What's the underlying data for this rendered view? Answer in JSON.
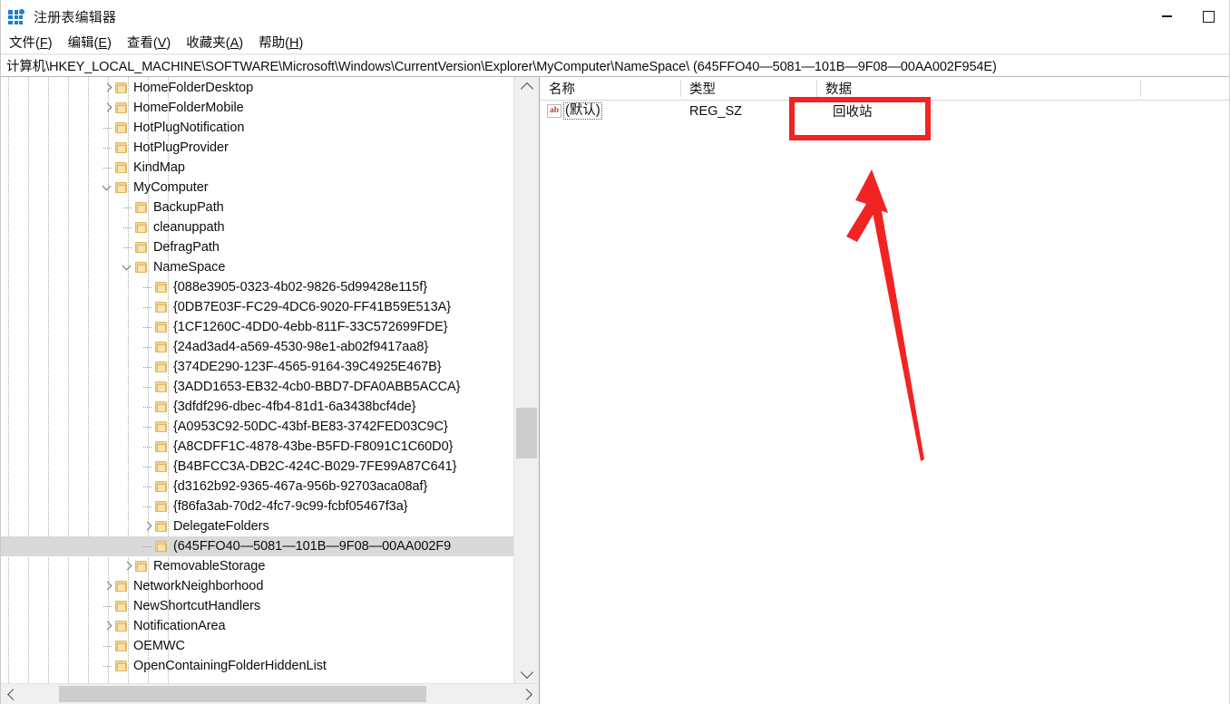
{
  "window": {
    "title": "注册表编辑器",
    "icon": "registry-editor-icon",
    "minimize_label": "最小化",
    "maximize_label": "最大化"
  },
  "menubar": {
    "items": [
      {
        "label": "文件(F)",
        "text": "文件(",
        "accel": "F",
        "tail": ")"
      },
      {
        "label": "编辑(E)",
        "text": "编辑(",
        "accel": "E",
        "tail": ")"
      },
      {
        "label": "查看(V)",
        "text": "查看(",
        "accel": "V",
        "tail": ")"
      },
      {
        "label": "收藏夹(A)",
        "text": "收藏夹(",
        "accel": "A",
        "tail": ")"
      },
      {
        "label": "帮助(H)",
        "text": "帮助(",
        "accel": "H",
        "tail": ")"
      }
    ]
  },
  "address": {
    "path": "计算机\\HKEY_LOCAL_MACHINE\\SOFTWARE\\Microsoft\\Windows\\CurrentVersion\\Explorer\\MyComputer\\NameSpace\\ (645FFO40—5081—101B—9F08—00AA002F954E)"
  },
  "tree": {
    "rows": [
      {
        "label": "HomeFolderDesktop",
        "indent": 6,
        "state": "expandable"
      },
      {
        "label": "HomeFolderMobile",
        "indent": 6,
        "state": "expandable"
      },
      {
        "label": "HotPlugNotification",
        "indent": 6,
        "state": "leaf"
      },
      {
        "label": "HotPlugProvider",
        "indent": 6,
        "state": "leaf"
      },
      {
        "label": "KindMap",
        "indent": 6,
        "state": "leaf"
      },
      {
        "label": "MyComputer",
        "indent": 6,
        "state": "expanded"
      },
      {
        "label": "BackupPath",
        "indent": 7,
        "state": "leaf"
      },
      {
        "label": "cleanuppath",
        "indent": 7,
        "state": "leaf"
      },
      {
        "label": "DefragPath",
        "indent": 7,
        "state": "leaf"
      },
      {
        "label": "NameSpace",
        "indent": 7,
        "state": "expanded"
      },
      {
        "label": "{088e3905-0323-4b02-9826-5d99428e115f}",
        "indent": 8,
        "state": "leaf"
      },
      {
        "label": "{0DB7E03F-FC29-4DC6-9020-FF41B59E513A}",
        "indent": 8,
        "state": "leaf"
      },
      {
        "label": "{1CF1260C-4DD0-4ebb-811F-33C572699FDE}",
        "indent": 8,
        "state": "leaf"
      },
      {
        "label": "{24ad3ad4-a569-4530-98e1-ab02f9417aa8}",
        "indent": 8,
        "state": "leaf"
      },
      {
        "label": "{374DE290-123F-4565-9164-39C4925E467B}",
        "indent": 8,
        "state": "leaf"
      },
      {
        "label": "{3ADD1653-EB32-4cb0-BBD7-DFA0ABB5ACCA}",
        "indent": 8,
        "state": "leaf"
      },
      {
        "label": "{3dfdf296-dbec-4fb4-81d1-6a3438bcf4de}",
        "indent": 8,
        "state": "leaf"
      },
      {
        "label": "{A0953C92-50DC-43bf-BE83-3742FED03C9C}",
        "indent": 8,
        "state": "leaf"
      },
      {
        "label": "{A8CDFF1C-4878-43be-B5FD-F8091C1C60D0}",
        "indent": 8,
        "state": "leaf"
      },
      {
        "label": "{B4BFCC3A-DB2C-424C-B029-7FE99A87C641}",
        "indent": 8,
        "state": "leaf"
      },
      {
        "label": "{d3162b92-9365-467a-956b-92703aca08af}",
        "indent": 8,
        "state": "leaf"
      },
      {
        "label": "{f86fa3ab-70d2-4fc7-9c99-fcbf05467f3a}",
        "indent": 8,
        "state": "leaf"
      },
      {
        "label": "DelegateFolders",
        "indent": 8,
        "state": "expandable"
      },
      {
        "label": "(645FFO40—5081—101B—9F08—00AA002F9",
        "indent": 8,
        "state": "leaf",
        "selected": true
      },
      {
        "label": "RemovableStorage",
        "indent": 7,
        "state": "expandable"
      },
      {
        "label": "NetworkNeighborhood",
        "indent": 6,
        "state": "expandable"
      },
      {
        "label": "NewShortcutHandlers",
        "indent": 6,
        "state": "leaf"
      },
      {
        "label": "NotificationArea",
        "indent": 6,
        "state": "expandable"
      },
      {
        "label": "OEMWC",
        "indent": 6,
        "state": "leaf"
      },
      {
        "label": "OpenContainingFolderHiddenList",
        "indent": 6,
        "state": "leaf"
      }
    ]
  },
  "values": {
    "columns": {
      "name": "名称",
      "type": "类型",
      "data": "数据"
    },
    "rows": [
      {
        "name": "(默认)",
        "icon": "ab",
        "type": "REG_SZ",
        "data": "回收站"
      }
    ]
  },
  "annotations": {
    "highlight_color": "#f22323",
    "box_target": "回收站",
    "arrow": "points-up-to-data-value"
  }
}
